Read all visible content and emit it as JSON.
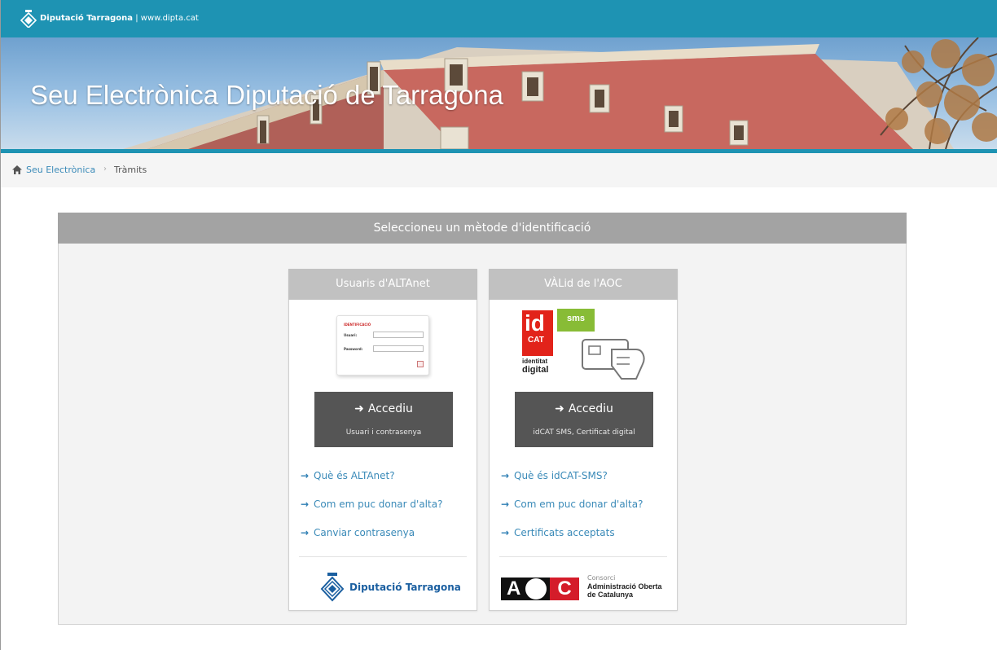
{
  "topbar": {
    "brand_name": "Diputació Tarragona",
    "brand_url": "www.dipta.cat"
  },
  "banner": {
    "title": "Seu Electrònica Diputació de Tarragona"
  },
  "breadcrumb": {
    "items": [
      "Seu Electrònica",
      "Tràmits"
    ],
    "separator": "›"
  },
  "panel": {
    "heading": "Seleccioneu un mètode d'identificació",
    "cards": [
      {
        "title": "Usuaris d'ALTAnet",
        "form_preview": {
          "heading": "IDENTIFICACIÓ",
          "field_1": "Usuari:",
          "field_2": "Password:"
        },
        "button": {
          "label": "Accediu",
          "sublabel": "Usuari i contrasenya"
        },
        "links": [
          "Què és ALTAnet?",
          "Com em puc donar d'alta?",
          "Canviar contrasenya"
        ],
        "footer_logo_text": "Diputació Tarragona"
      },
      {
        "title": "VÀLid de l'AOC",
        "badge": {
          "line1": "id",
          "line2": "CAT",
          "sub1": "identitat",
          "sub2": "digital",
          "sms": "sms"
        },
        "button": {
          "label": "Accediu",
          "sublabel": "idCAT SMS, Certificat digital"
        },
        "links": [
          "Què és idCAT-SMS?",
          "Com em puc donar d'alta?",
          "Certificats acceptats"
        ],
        "footer_logo": {
          "letter_a": "A",
          "letter_c": "C",
          "line0": "Consorci",
          "line1": "Administració Oberta",
          "line2": "de Catalunya"
        }
      }
    ]
  },
  "colors": {
    "accent": "#1e93b3",
    "panel_header": "#a3a3a3",
    "card_header": "#c1c1c1",
    "button": "#555555",
    "link": "#3a8ab8",
    "idcat_red": "#e2231a",
    "sms_green": "#88bc36",
    "aoc_red": "#d41c2a"
  },
  "icons": {
    "topbar_logo": "diputacio-logo-icon",
    "breadcrumb_home": "home-icon",
    "link_arrow": "arrow-right-icon"
  }
}
